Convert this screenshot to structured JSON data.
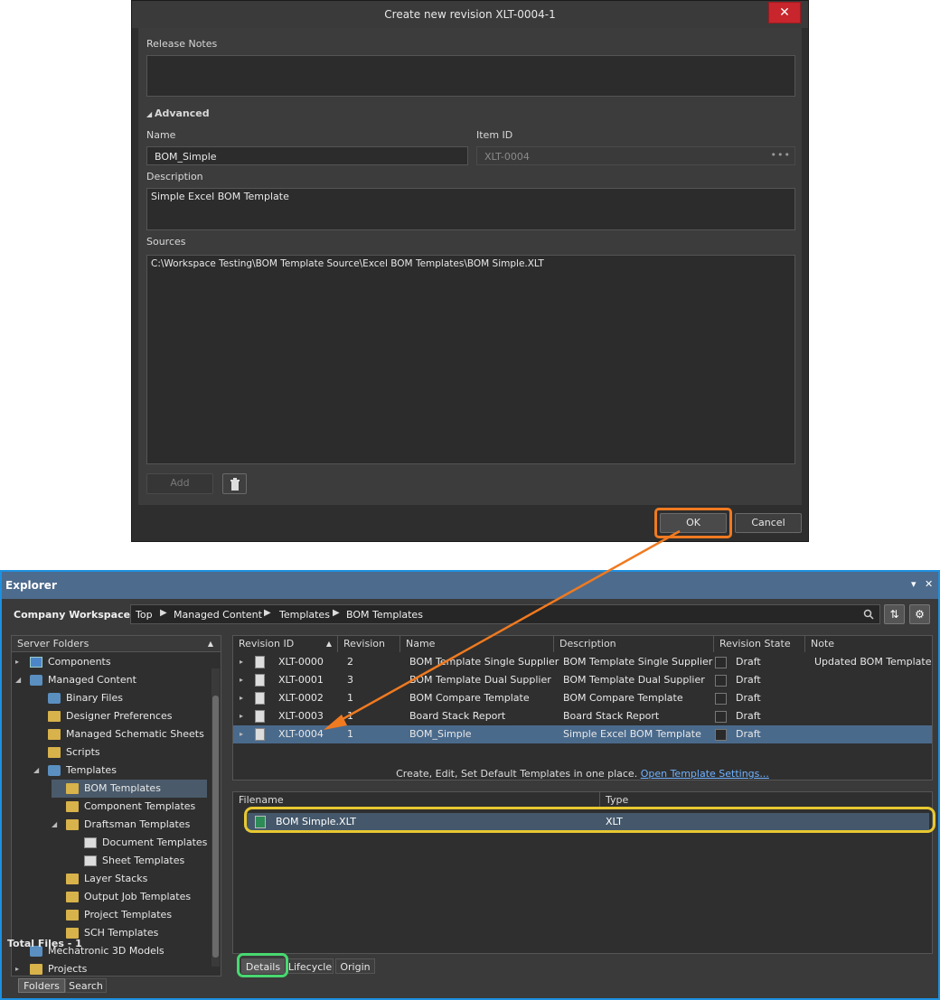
{
  "dialog": {
    "title": "Create new revision XLT-0004-1",
    "close_glyph": "✕",
    "release_notes_label": "Release Notes",
    "release_notes_value": "",
    "advanced_label": "Advanced",
    "name_label": "Name",
    "name_value": "BOM_Simple",
    "item_id_label": "Item ID",
    "item_id_value": "XLT-0004",
    "item_id_dots": "•••",
    "description_label": "Description",
    "description_value": "Simple Excel BOM Template",
    "sources_label": "Sources",
    "sources_value": "C:\\Workspace Testing\\BOM Template Source\\Excel BOM Templates\\BOM Simple.XLT",
    "add_button": "Add",
    "ok_button": "OK",
    "cancel_button": "Cancel"
  },
  "explorer": {
    "title": "Explorer",
    "pin_glyph": "▾",
    "close_glyph": "✕",
    "workspace": "Company Workspace",
    "breadcrumb": [
      "Top",
      "Managed Content",
      "Templates",
      "BOM Templates"
    ],
    "server_folders_label": "Server Folders",
    "tree": [
      {
        "label": "Components",
        "level": 0,
        "icon": "component-icon",
        "expand": "▸"
      },
      {
        "label": "Managed Content",
        "level": 0,
        "icon": "folder-icon",
        "expand": "◢"
      },
      {
        "label": "Binary Files",
        "level": 1,
        "icon": "folder-icon",
        "expand": ""
      },
      {
        "label": "Designer Preferences",
        "level": 1,
        "icon": "preferences-icon",
        "expand": ""
      },
      {
        "label": "Managed Schematic Sheets",
        "level": 1,
        "icon": "sheets-icon",
        "expand": ""
      },
      {
        "label": "Scripts",
        "level": 1,
        "icon": "scripts-icon",
        "expand": ""
      },
      {
        "label": "Templates",
        "level": 1,
        "icon": "folder-icon",
        "expand": "◢"
      },
      {
        "label": "BOM Templates",
        "level": 2,
        "icon": "bom-template-icon",
        "expand": "",
        "selected": true
      },
      {
        "label": "Component Templates",
        "level": 2,
        "icon": "component-template-icon",
        "expand": ""
      },
      {
        "label": "Draftsman Templates",
        "level": 2,
        "icon": "draftsman-icon",
        "expand": "◢"
      },
      {
        "label": "Document Templates",
        "level": 3,
        "icon": "document-icon",
        "expand": ""
      },
      {
        "label": "Sheet Templates",
        "level": 3,
        "icon": "sheet-icon",
        "expand": ""
      },
      {
        "label": "Layer Stacks",
        "level": 2,
        "icon": "layer-stack-icon",
        "expand": ""
      },
      {
        "label": "Output Job Templates",
        "level": 2,
        "icon": "output-job-icon",
        "expand": ""
      },
      {
        "label": "Project Templates",
        "level": 2,
        "icon": "project-template-icon",
        "expand": ""
      },
      {
        "label": "SCH Templates",
        "level": 2,
        "icon": "sch-template-icon",
        "expand": ""
      },
      {
        "label": "Mechatronic 3D Models",
        "level": 0,
        "icon": "folder-icon",
        "expand": ""
      },
      {
        "label": "Projects",
        "level": 0,
        "icon": "projects-icon",
        "expand": "▸"
      }
    ],
    "left_tabs": [
      "Folders",
      "Search"
    ],
    "columns": [
      "Revision ID",
      "Revision",
      "Name",
      "Description",
      "Revision State",
      "Note"
    ],
    "rows": [
      {
        "id": "XLT-0000",
        "rev": "2",
        "name": "BOM Template Single Supplier",
        "desc": "BOM Template Single Supplier",
        "state": "Draft",
        "note": "Updated BOM Template"
      },
      {
        "id": "XLT-0001",
        "rev": "3",
        "name": "BOM Template Dual Supplier",
        "desc": "BOM Template Dual Supplier",
        "state": "Draft",
        "note": ""
      },
      {
        "id": "XLT-0002",
        "rev": "1",
        "name": "BOM Compare Template",
        "desc": "BOM Compare Template",
        "state": "Draft",
        "note": ""
      },
      {
        "id": "XLT-0003",
        "rev": "1",
        "name": "Board Stack Report",
        "desc": "Board Stack Report",
        "state": "Draft",
        "note": ""
      },
      {
        "id": "XLT-0004",
        "rev": "1",
        "name": "BOM_Simple",
        "desc": "Simple Excel BOM Template",
        "state": "Draft",
        "note": "",
        "selected": true
      }
    ],
    "footer_text": "Create, Edit, Set Default Templates in one place.",
    "footer_link": "Open Template Settings...",
    "file_columns": [
      "Filename",
      "Type"
    ],
    "files": [
      {
        "name": "BOM Simple.XLT",
        "type": "XLT"
      }
    ],
    "total_files": "Total Files - 1",
    "bottom_tabs": [
      "Details",
      "Lifecycle",
      "Origin"
    ]
  },
  "colors": {
    "accent_orange": "#f07a20",
    "highlight_yellow": "#e8c830",
    "highlight_green": "#48d870",
    "title_blue": "#1e90e0"
  }
}
